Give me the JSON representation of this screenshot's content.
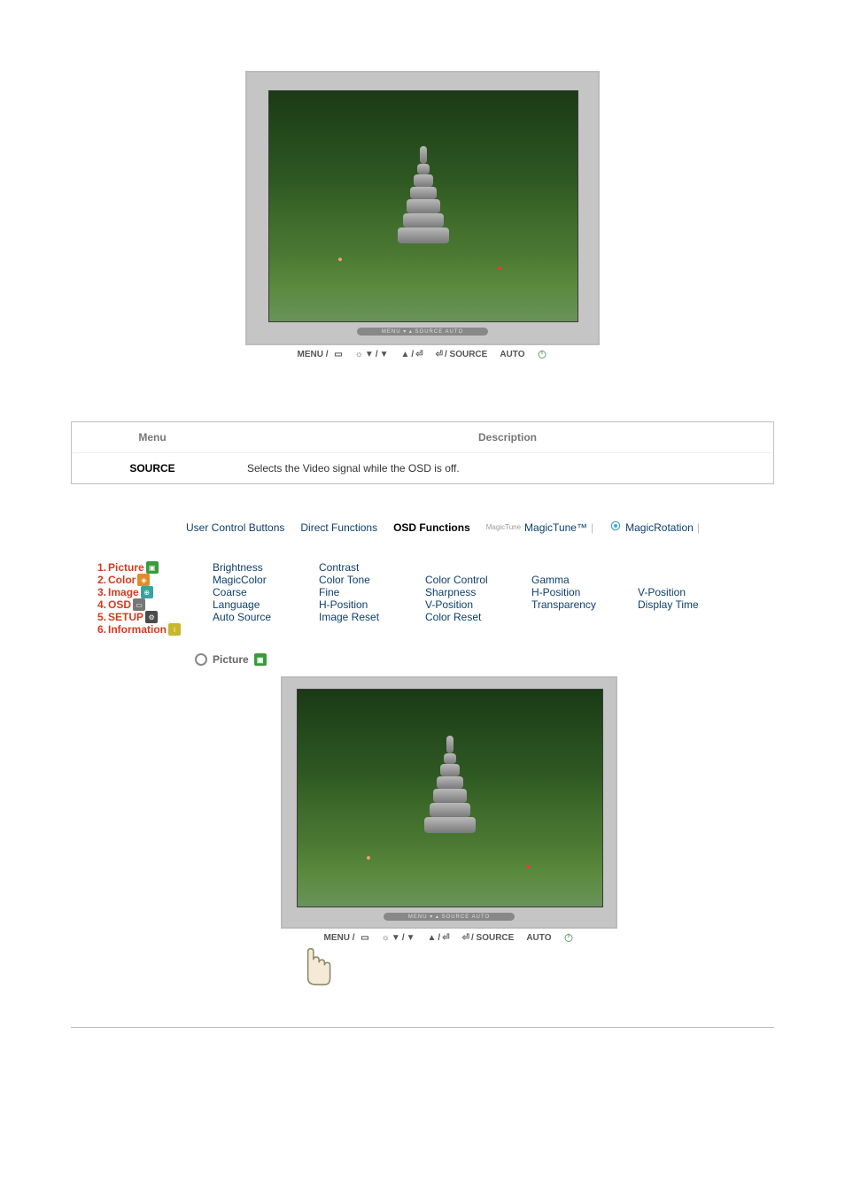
{
  "buttons": {
    "menu": "MENU /",
    "menu_icon": "▭",
    "down": "▼",
    "up": "▲",
    "enter_source": "/ SOURCE",
    "auto": "AUTO"
  },
  "table": {
    "header_menu": "Menu",
    "header_desc": "Description",
    "row_menu": "SOURCE",
    "row_desc": "Selects the Video signal while the OSD is off."
  },
  "tabs": {
    "t1": "User Control Buttons",
    "t2": "Direct Functions",
    "t3": "OSD Functions",
    "t4_prefix": "MagicTune",
    "t4": "MagicTune™",
    "t5": "MagicRotation"
  },
  "categories": [
    {
      "num": "1.",
      "name": "Picture",
      "cols": [
        "Brightness",
        "Contrast",
        "",
        "",
        ""
      ]
    },
    {
      "num": "2.",
      "name": "Color",
      "cols": [
        "MagicColor",
        "Color Tone",
        "Color Control",
        "Gamma",
        ""
      ]
    },
    {
      "num": "3.",
      "name": "Image",
      "cols": [
        "Coarse",
        "Fine",
        "Sharpness",
        "H-Position",
        "V-Position"
      ]
    },
    {
      "num": "4.",
      "name": "OSD",
      "cols": [
        "Language",
        "H-Position",
        "V-Position",
        "Transparency",
        "Display Time"
      ]
    },
    {
      "num": "5.",
      "name": "SETUP",
      "cols": [
        "Auto Source",
        "Image Reset",
        "Color Reset",
        "",
        ""
      ]
    },
    {
      "num": "6.",
      "name": "Information",
      "cols": [
        "",
        "",
        "",
        "",
        ""
      ]
    }
  ],
  "section_heading": "Picture",
  "bezel_strip": "MENU  ▾ ▴  SOURCE  AUTO"
}
